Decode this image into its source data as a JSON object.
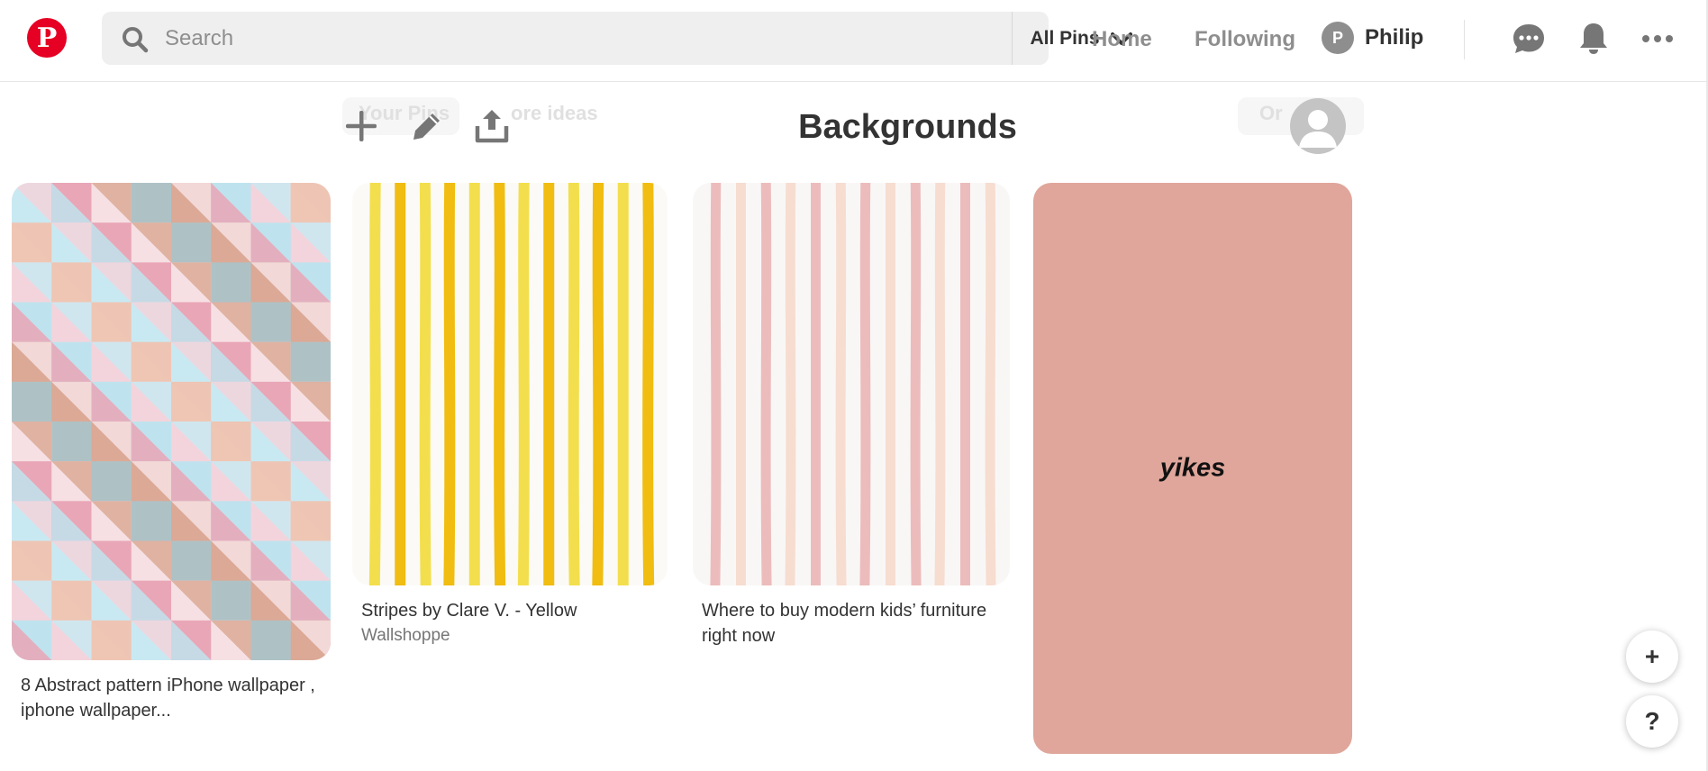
{
  "header": {
    "logo_letter": "P",
    "search_placeholder": "Search",
    "filter_label": "All Pins",
    "nav": {
      "home": "Home",
      "following": "Following"
    },
    "user": {
      "initial": "P",
      "name": "Philip"
    },
    "icons": [
      "speech-bubble-icon",
      "bell-icon",
      "more-icon"
    ]
  },
  "board": {
    "title": "Backgrounds",
    "ghost_tabs": {
      "your_pins": "Your Pins",
      "more_ideas": "ore ideas",
      "organize": "Or"
    },
    "tools": [
      "plus-icon",
      "pencil-icon",
      "share-upload-icon"
    ]
  },
  "pins": [
    {
      "title_line1": "8 Abstract pattern iPhone wallpaper ,",
      "title_line2": "iphone wallpaper..."
    },
    {
      "title": "Stripes by Clare V. - Yellow",
      "source": "Wallshoppe"
    },
    {
      "title_line1": "Where to buy modern kids’ furniture",
      "title_line2": "right now"
    },
    {
      "overlay_text": "yikes",
      "bg_color": "#e0a69b"
    }
  ],
  "floating": {
    "add": "+",
    "help": "?"
  },
  "colors": {
    "brand": "#e60023",
    "pin4_bg": "#e0a69b"
  }
}
